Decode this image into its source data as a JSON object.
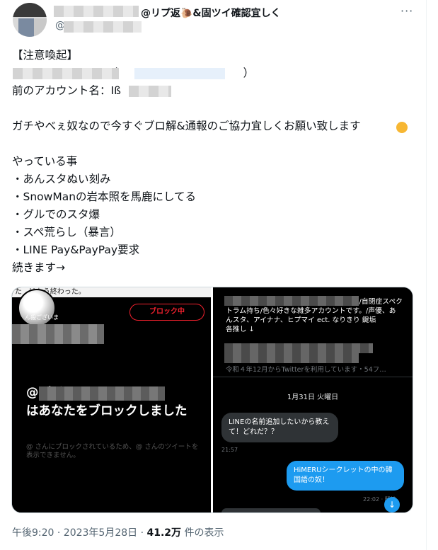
{
  "tweet": {
    "name_suffix": "@リプ返🐌&固ツイ確認宜しく",
    "handle_prefix": "@",
    "more_label": "···",
    "body": "【注意喚起】\n                        い（                                    ）\n前のアカウント名：Iß\n\nガチやべぇ奴なので今すぐブロ解&通報のご協力宜しくお願い致します\n\nやっている事\n・あんスタぬい刻み\n・SnowManの岩本照を馬鹿にしてる\n・グルでのスタ爆\n・スペ荒らし（暴言）\n・LINE Pay&PayPay要求\n続きます→"
  },
  "media": {
    "left": {
      "top_strip": "た　はもう終わった。",
      "avatar_label": "ん殺ございま",
      "block_button": "ブロック中",
      "headline": "@                    さん\nはあなたをブロックしました",
      "subtext": "@              さんにブロックされているため、@              さんのツイートを表示できません。"
    },
    "right": {
      "bio": "                              と申します。女です。18↑/障害者手帳２級/自閉症スペクトラム持ち/色々好きな雑多アカウントです。/声優、あんスタ、アイナナ、ヒプマイ ect. なりきり                              鍵垢\n                                    各推し ↓",
      "joined": "令和４年12月からTwitterを利用しています・54フ…",
      "day": "1月31日 火曜日",
      "msg_in": "LINEの名前追加したいから教えて！どれだ？？",
      "time_in": "21:57",
      "msg_out": "HiMERUシークレットの中の韓国語の奴！",
      "time_out": "22:02 · 既読",
      "down_icon": "↓"
    }
  },
  "meta": {
    "time": "午後9:20 · 2023年5月28日 · ",
    "views_count": "41.2万",
    "views_label": " 件の表示"
  },
  "colors": {
    "block_red": "#f4212e",
    "accent_blue": "#1d9bf0"
  }
}
